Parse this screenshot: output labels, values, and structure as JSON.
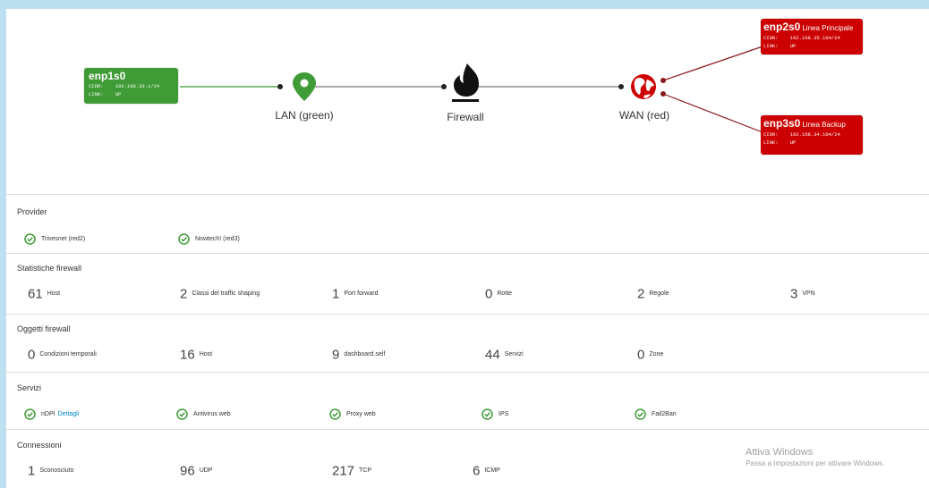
{
  "topology": {
    "green_iface": {
      "name": "enp1s0",
      "desc": "",
      "cidr_label": "CIDR:",
      "cidr": "192.168.33.1/24",
      "link_label": "LINK:",
      "link": "UP"
    },
    "red_iface_1": {
      "name": "enp2s0",
      "desc": "Linea Principale",
      "cidr_label": "CIDR:",
      "cidr": "192.168.35.104/24",
      "link_label": "LINK:",
      "link": "UP"
    },
    "red_iface_2": {
      "name": "enp3s0",
      "desc": "Linea Backup",
      "cidr_label": "CIDR:",
      "cidr": "192.168.34.104/24",
      "link_label": "LINK:",
      "link": "UP"
    },
    "lan_label": "LAN (green)",
    "firewall_label": "Firewall",
    "wan_label": "WAN (red)",
    "colors": {
      "green": "#3f9b35",
      "red": "#cc0000",
      "dark": "#222222"
    }
  },
  "provider": {
    "title": "Provider",
    "items": [
      {
        "label": "Trivesnet (red2)",
        "icon": "check-circle-icon"
      },
      {
        "label": "Nowtech! (red3)",
        "icon": "check-circle-icon"
      }
    ]
  },
  "firewall_stats": {
    "title": "Statistiche firewall",
    "items": [
      {
        "num": "61",
        "label": "Host"
      },
      {
        "num": "2",
        "label": "Classi del traffic shaping"
      },
      {
        "num": "1",
        "label": "Port forward"
      },
      {
        "num": "0",
        "label": "Rotte"
      },
      {
        "num": "2",
        "label": "Regole"
      },
      {
        "num": "3",
        "label": "VPN"
      }
    ]
  },
  "firewall_objects": {
    "title": "Oggetti firewall",
    "items": [
      {
        "num": "0",
        "label": "Condizioni temporali"
      },
      {
        "num": "16",
        "label": "Host"
      },
      {
        "num": "9",
        "label": "dashboard.self"
      },
      {
        "num": "44",
        "label": "Servizi"
      },
      {
        "num": "0",
        "label": "Zone"
      }
    ]
  },
  "services": {
    "title": "Servizi",
    "items": [
      {
        "label": "nDPI",
        "link": "Dettagli",
        "icon": "check-circle-icon"
      },
      {
        "label": "Antivirus web",
        "icon": "check-circle-icon"
      },
      {
        "label": "Proxy web",
        "icon": "check-circle-icon"
      },
      {
        "label": "IPS",
        "icon": "check-circle-icon"
      },
      {
        "label": "Fail2Ban",
        "icon": "check-circle-icon"
      }
    ]
  },
  "connections": {
    "title": "Connessioni",
    "items": [
      {
        "num": "1",
        "label": "Sconosciuto"
      },
      {
        "num": "96",
        "label": "UDP"
      },
      {
        "num": "217",
        "label": "TCP"
      },
      {
        "num": "6",
        "label": "ICMP"
      }
    ]
  },
  "windows_activation": {
    "line1": "Attiva Windows",
    "line2": "Passa a Impostazioni per attivare Windows."
  }
}
